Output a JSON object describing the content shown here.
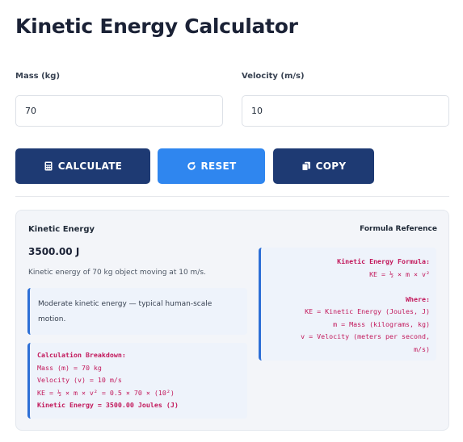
{
  "title": "Kinetic Energy Calculator",
  "mass": {
    "label": "Mass (kg)",
    "value": "70"
  },
  "velocity": {
    "label": "Velocity (m/s)",
    "value": "10"
  },
  "buttons": {
    "calculate": {
      "label": "CALCULATE",
      "icon": "calculator-icon",
      "color": "#1e3a73"
    },
    "reset": {
      "label": "RESET",
      "icon": "refresh-icon",
      "color": "#2f86ef"
    },
    "copy": {
      "label": "COPY",
      "icon": "copy-icon",
      "color": "#1e3a73"
    }
  },
  "result": {
    "label": "Kinetic Energy",
    "value": "3500.00 J",
    "description": "Kinetic energy of 70 kg object moving at 10 m/s.",
    "note": "Moderate kinetic energy — typical human-scale motion."
  },
  "breakdown": {
    "heading": "Calculation Breakdown:",
    "lines": [
      "Mass (m) = 70 kg",
      "Velocity (v) = 10 m/s",
      "KE = ½ × m × v² = 0.5 × 70 × (10²)"
    ],
    "result_line": "Kinetic Energy = 3500.00 Joules (J)"
  },
  "formula_reference": {
    "label": "Formula Reference",
    "heading": "Kinetic Energy Formula:",
    "formula": "KE = ½ × m × v²",
    "where_heading": "Where:",
    "where_lines": [
      "KE = Kinetic Energy (Joules, J)",
      "m = Mass (kilograms, kg)",
      "v = Velocity (meters per second,",
      "m/s)"
    ]
  },
  "colors": {
    "accent": "#2d6fd6",
    "navy": "#1e3a73",
    "blue": "#2f86ef",
    "code_text": "#c2185b"
  }
}
